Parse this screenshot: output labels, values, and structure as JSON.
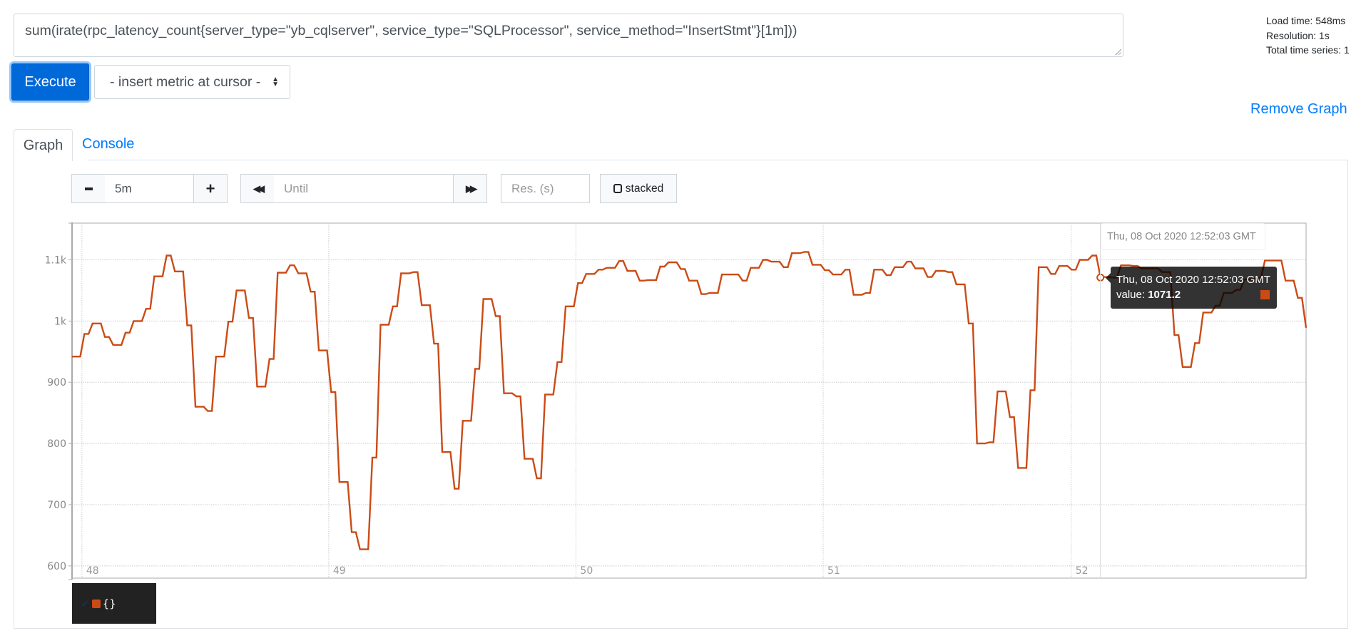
{
  "query": {
    "expression": "sum(irate(rpc_latency_count{server_type=\"yb_cqlserver\", service_type=\"SQLProcessor\", service_method=\"InsertStmt\"}[1m]))",
    "execute_label": "Execute",
    "insert_metric_label": "- insert metric at cursor -"
  },
  "status": {
    "load_time": "Load time: 548ms",
    "resolution": "Resolution: 1s",
    "total_series": "Total time series: 1"
  },
  "remove_graph_label": "Remove Graph",
  "tabs": [
    {
      "label": "Graph",
      "active": true
    },
    {
      "label": "Console",
      "active": false
    }
  ],
  "controls": {
    "minus_icon": "minus-icon",
    "range_value": "5m",
    "plus_icon": "plus-icon",
    "rewind_icon": "double-chevron-left-icon",
    "until_placeholder": "Until",
    "forward_icon": "double-chevron-right-icon",
    "resolution_placeholder": "Res. (s)",
    "stacked_label": "stacked",
    "stacked_checked": false
  },
  "hover": {
    "time_label": "Thu, 08 Oct 2020 12:52:03 GMT",
    "tooltip_time": "Thu, 08 Oct 2020 12:52:03 GMT",
    "tooltip_value_label": "value: ",
    "tooltip_value": "1071.2",
    "hover_second": 250
  },
  "legend": {
    "items": [
      {
        "label": "{}",
        "color": "#cb4b16",
        "checked": true
      }
    ]
  },
  "colors": {
    "series": "#cb4b16",
    "accent": "#007bff",
    "execute": "#0069d9"
  },
  "chart_data": {
    "type": "line",
    "title": "",
    "xlabel": "",
    "ylabel": "",
    "x_range_seconds": [
      0,
      300
    ],
    "ylim": [
      580,
      1160
    ],
    "y_ticks": [
      {
        "value": 600,
        "label": "600"
      },
      {
        "value": 700,
        "label": "700"
      },
      {
        "value": 800,
        "label": "800"
      },
      {
        "value": 900,
        "label": "900"
      },
      {
        "value": 1000,
        "label": "1k"
      },
      {
        "value": 1100,
        "label": "1.1k"
      }
    ],
    "x_ticks": [
      {
        "second": 2.4,
        "label": "48"
      },
      {
        "second": 62.4,
        "label": "49"
      },
      {
        "second": 122.5,
        "label": "50"
      },
      {
        "second": 182.6,
        "label": "51"
      },
      {
        "second": 242.9,
        "label": "52"
      }
    ],
    "grid": true,
    "step_seconds": 2.5,
    "series": [
      {
        "name": "{}",
        "step_values": [
          942,
          979,
          996,
          974,
          961,
          981,
          1000,
          1020,
          1073,
          1107,
          1081,
          993,
          860,
          853,
          942,
          999,
          1050,
          1005,
          893,
          938,
          1079,
          1091,
          1078,
          1048,
          952,
          884,
          737,
          655,
          627,
          777,
          994,
          1024,
          1078,
          1080,
          1026,
          963,
          786,
          726,
          837,
          922,
          1036,
          1008,
          882,
          877,
          775,
          743,
          880,
          933,
          1024,
          1062,
          1077,
          1084,
          1087,
          1098,
          1082,
          1066,
          1067,
          1089,
          1096,
          1085,
          1066,
          1044,
          1046,
          1076,
          1076,
          1066,
          1087,
          1100,
          1097,
          1088,
          1111,
          1113,
          1092,
          1083,
          1076,
          1084,
          1043,
          1046,
          1084,
          1075,
          1088,
          1097,
          1086,
          1072,
          1082,
          1080,
          1060,
          996,
          800,
          802,
          885,
          843,
          760,
          887,
          1088,
          1077,
          1090,
          1084,
          1100,
          1107,
          1072,
          1071,
          1091,
          1090,
          1086,
          1086,
          1080,
          977,
          925,
          964,
          1014,
          1025,
          1046,
          1051,
          1068,
          1070,
          1099,
          1099,
          1066,
          1038
        ],
        "final_value": 989
      }
    ]
  }
}
